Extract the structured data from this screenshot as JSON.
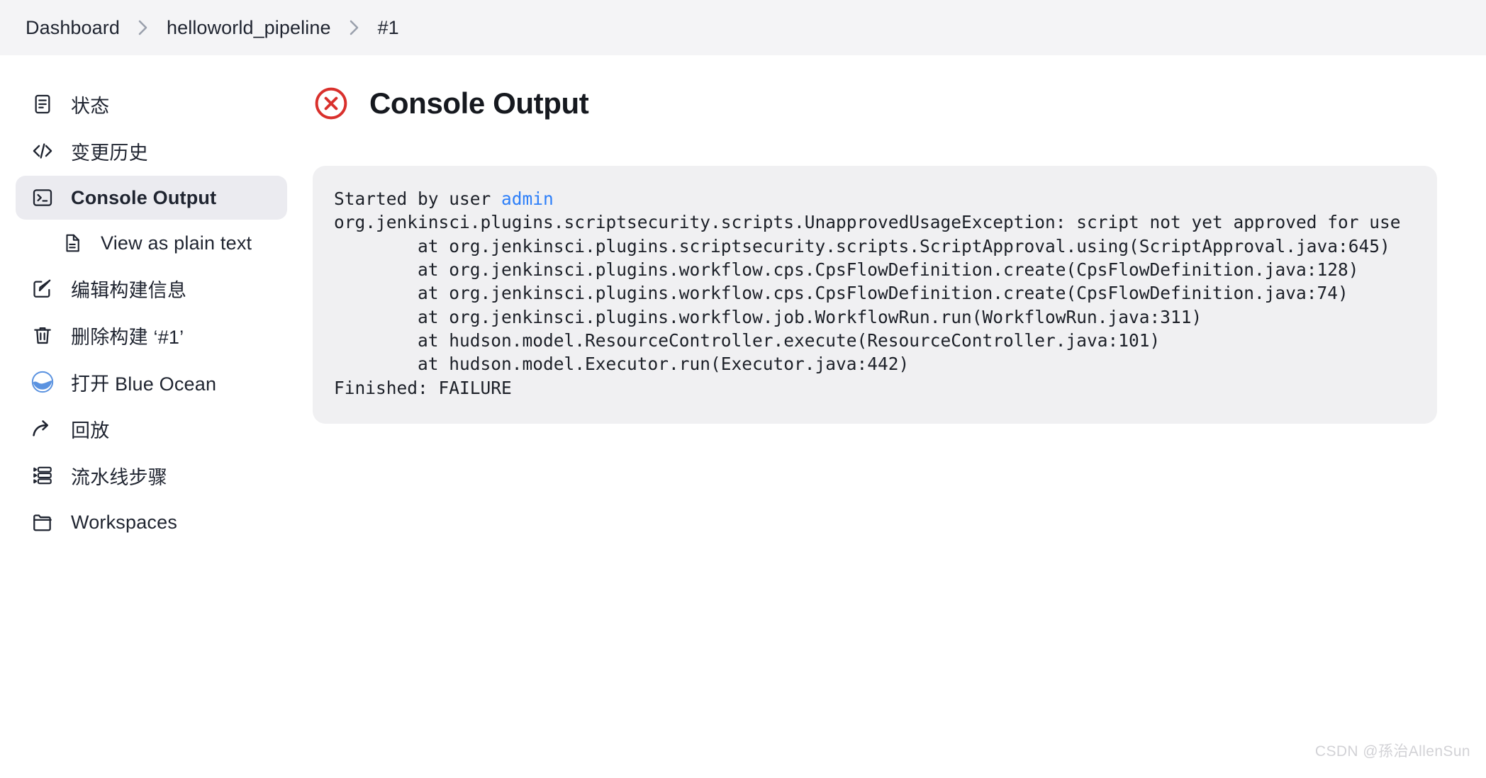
{
  "breadcrumb": {
    "items": [
      {
        "label": "Dashboard",
        "name": "breadcrumb-dashboard"
      },
      {
        "label": "helloworld_pipeline",
        "name": "breadcrumb-pipeline"
      },
      {
        "label": "#1",
        "name": "breadcrumb-build"
      }
    ]
  },
  "sidebar": {
    "items": [
      {
        "label": "状态",
        "icon": "status-document-icon",
        "name": "sidebar-item-status",
        "selected": false,
        "sub": false
      },
      {
        "label": "变更历史",
        "icon": "code-brackets-icon",
        "name": "sidebar-item-changes",
        "selected": false,
        "sub": false
      },
      {
        "label": "Console Output",
        "icon": "terminal-icon",
        "name": "sidebar-item-console-output",
        "selected": true,
        "sub": false
      },
      {
        "label": "View as plain text",
        "icon": "plain-text-file-icon",
        "name": "sidebar-item-view-as-plain-text",
        "selected": false,
        "sub": true
      },
      {
        "label": "编辑构建信息",
        "icon": "edit-square-icon",
        "name": "sidebar-item-edit-build-information",
        "selected": false,
        "sub": false
      },
      {
        "label": "删除构建 ‘#1’",
        "icon": "trash-icon",
        "name": "sidebar-item-delete-build",
        "selected": false,
        "sub": false
      },
      {
        "label": "打开 Blue Ocean",
        "icon": "blue-ocean-icon",
        "name": "sidebar-item-open-blue-ocean",
        "selected": false,
        "sub": false
      },
      {
        "label": "回放",
        "icon": "replay-arrow-icon",
        "name": "sidebar-item-replay",
        "selected": false,
        "sub": false
      },
      {
        "label": "流水线步骤",
        "icon": "pipeline-steps-icon",
        "name": "sidebar-item-pipeline-steps",
        "selected": false,
        "sub": false
      },
      {
        "label": "Workspaces",
        "icon": "folder-icon",
        "name": "sidebar-item-workspaces",
        "selected": false,
        "sub": false
      }
    ]
  },
  "main": {
    "title": "Console Output",
    "status": "failure",
    "status_icon": "error-circle-x-icon",
    "status_color": "#d9302c",
    "console": {
      "started_by_prefix": "Started by user ",
      "started_by_user": "admin",
      "lines": [
        "org.jenkinsci.plugins.scriptsecurity.scripts.UnapprovedUsageException: script not yet approved for use",
        "\tat org.jenkinsci.plugins.scriptsecurity.scripts.ScriptApproval.using(ScriptApproval.java:645)",
        "\tat org.jenkinsci.plugins.workflow.cps.CpsFlowDefinition.create(CpsFlowDefinition.java:128)",
        "\tat org.jenkinsci.plugins.workflow.cps.CpsFlowDefinition.create(CpsFlowDefinition.java:74)",
        "\tat org.jenkinsci.plugins.workflow.job.WorkflowRun.run(WorkflowRun.java:311)",
        "\tat hudson.model.ResourceController.execute(ResourceController.java:101)",
        "\tat hudson.model.Executor.run(Executor.java:442)",
        "Finished: FAILURE"
      ]
    }
  },
  "watermark": "CSDN @孫治AllenSun"
}
